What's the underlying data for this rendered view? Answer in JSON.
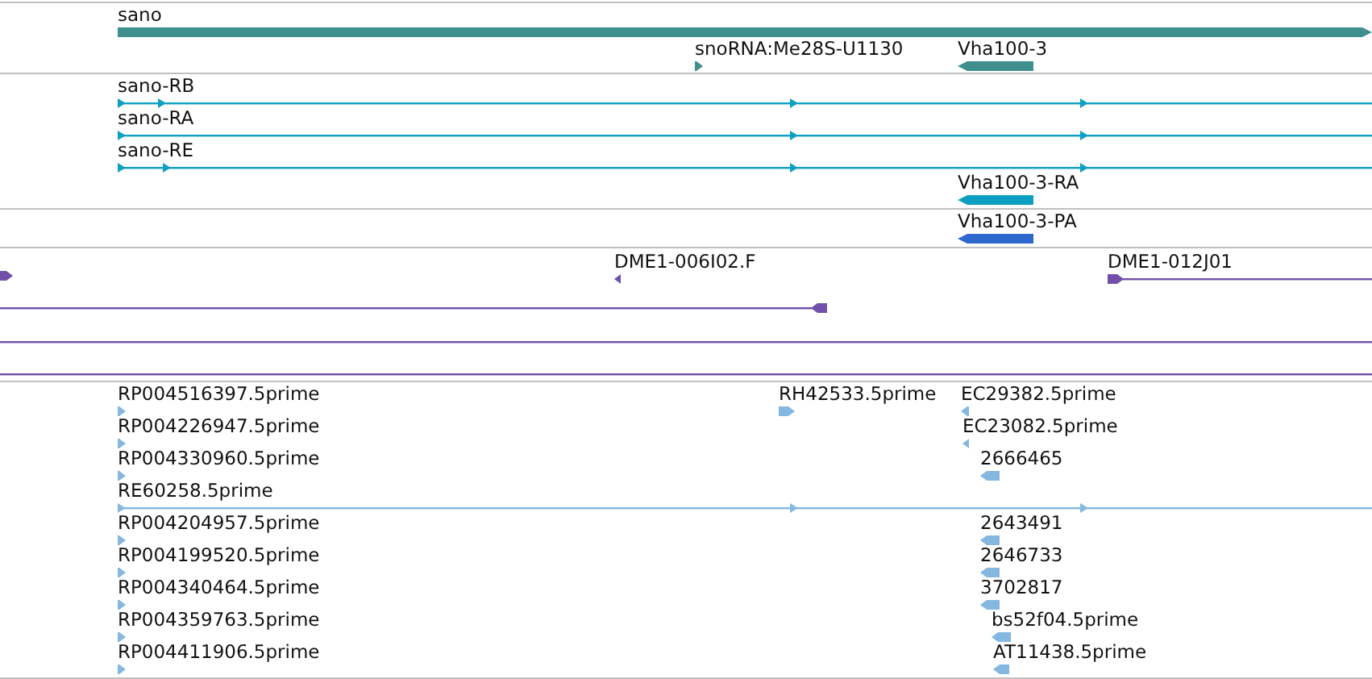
{
  "tracks": [
    {
      "kind": "gene",
      "features": [
        {
          "kind": "bar",
          "label": "sano",
          "reverse": false
        },
        {
          "kind": "arrow",
          "label": "snoRNA:Me28S-U1130",
          "reverse": false
        },
        {
          "kind": "bar",
          "label": "Vha100-3",
          "reverse": true
        }
      ]
    },
    {
      "kind": "transcript",
      "features": [
        {
          "kind": "line",
          "label": "sano-RB",
          "reverse": false
        },
        {
          "kind": "line",
          "label": "sano-RA",
          "reverse": false
        },
        {
          "kind": "line",
          "label": "sano-RE",
          "reverse": false
        },
        {
          "kind": "bar",
          "label": "Vha100-3-RA",
          "reverse": true
        }
      ]
    },
    {
      "kind": "protein",
      "features": [
        {
          "kind": "bar",
          "label": "Vha100-3-PA",
          "reverse": true
        }
      ]
    },
    {
      "kind": "clone",
      "features": [
        {
          "kind": "arrow",
          "reverse": false
        },
        {
          "kind": "arrow",
          "label": "DME1-006I02.F",
          "reverse": true
        },
        {
          "kind": "line",
          "label": "DME1-012J01",
          "reverse": false
        },
        {
          "kind": "line",
          "reverse": true
        },
        {
          "kind": "line"
        },
        {
          "kind": "line"
        }
      ]
    },
    {
      "kind": "est",
      "features": [
        {
          "kind": "arrow",
          "label": "RP004516397.5prime",
          "reverse": false
        },
        {
          "kind": "arrow",
          "label": "RH42533.5prime",
          "reverse": false
        },
        {
          "kind": "arrow",
          "label": "EC29382.5prime",
          "reverse": true
        },
        {
          "kind": "arrow",
          "label": "RP004226947.5prime",
          "reverse": false
        },
        {
          "kind": "arrow",
          "label": "EC23082.5prime",
          "reverse": true
        },
        {
          "kind": "arrow",
          "label": "RP004330960.5prime",
          "reverse": false
        },
        {
          "kind": "arrow",
          "label": "2666465",
          "reverse": true
        },
        {
          "kind": "line",
          "label": "RE60258.5prime",
          "reverse": false
        },
        {
          "kind": "arrow",
          "label": "RP004204957.5prime",
          "reverse": false
        },
        {
          "kind": "arrow",
          "label": "2643491",
          "reverse": true
        },
        {
          "kind": "arrow",
          "label": "RP004199520.5prime",
          "reverse": false
        },
        {
          "kind": "arrow",
          "label": "2646733",
          "reverse": true
        },
        {
          "kind": "arrow",
          "label": "RP004340464.5prime",
          "reverse": false
        },
        {
          "kind": "arrow",
          "label": "3702817",
          "reverse": true
        },
        {
          "kind": "arrow",
          "label": "RP004359763.5prime",
          "reverse": false
        },
        {
          "kind": "arrow",
          "label": "bs52f04.5prime",
          "reverse": true
        },
        {
          "kind": "arrow",
          "label": "RP004411906.5prime",
          "reverse": false
        },
        {
          "kind": "arrow",
          "label": "AT11438.5prime",
          "reverse": true
        }
      ]
    }
  ]
}
